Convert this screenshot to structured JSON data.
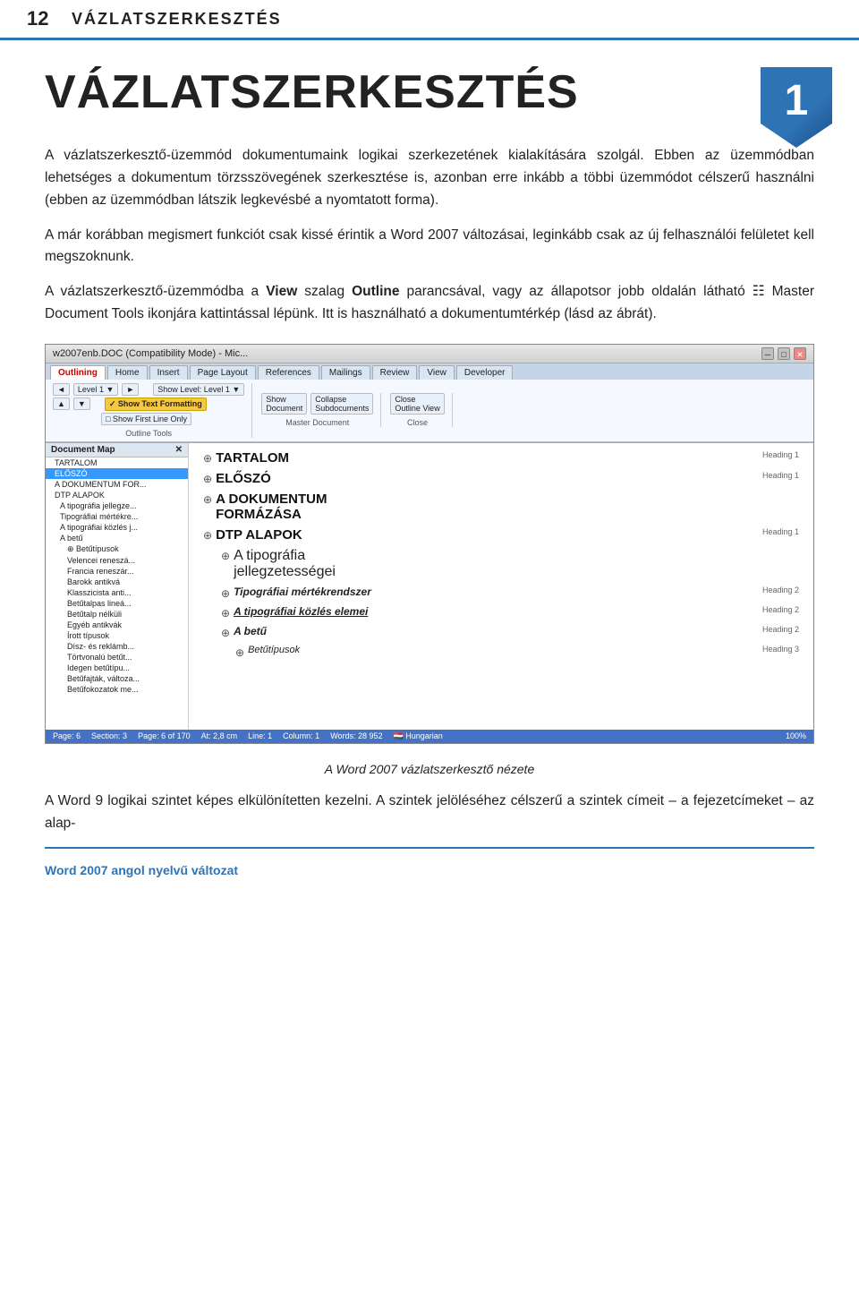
{
  "header": {
    "chapter_number": "12",
    "chapter_title": "VÁZLATSZERKESZTÉS"
  },
  "big_title": "VÁZLATSZERKESZTÉS",
  "badge_number": "1",
  "paragraphs": [
    "A vázlatszerkesztő-üzemmód dokumentumaink logikai szerkezetének kialakítására szolgál. Ebben az üzemmódban lehetséges a dokumentum törzsszövegének szerkesztése is, azonban erre inkább a többi üzemmódot célszerű használni (ebben az üzemmódban látszik legkevésbé a nyomtatott forma).",
    "A már korábban megismert funkciót csak kissé érintik a Word 2007 változásai, leginkább csak az új felhasználói felületet kell megszoknunk.",
    "A vázlatszerkesztő-üzemmódba a View szalag Outline parancsával, vagy az állapotsor jobb oldalán látható 🖹 Master Document Tools ikonjára kattintással lépünk. Itt is használható a dokumentumtérkép (lásd az ábrát)."
  ],
  "word_window": {
    "title": "w2007enb.DOC (Compatibility Mode) - Mic...",
    "tabs": [
      "Outlining",
      "Home",
      "Insert",
      "Page Layout",
      "References",
      "Mailings",
      "Review",
      "View",
      "Developer"
    ],
    "active_tab": "Outlining",
    "ribbon": {
      "groups": [
        {
          "label": "Outline Tools",
          "buttons": [
            {
              "label": "◄ Level 1 ►",
              "type": "dropdown"
            },
            {
              "label": "Show Level: Level 1",
              "type": "dropdown"
            },
            {
              "label": "Show Text Formatting",
              "type": "toggle",
              "highlighted": true
            },
            {
              "label": "Show First Line Only",
              "type": "toggle"
            }
          ]
        },
        {
          "label": "Master Document",
          "buttons": [
            {
              "label": "Show Document",
              "type": "btn"
            },
            {
              "label": "Collapse Subdocuments",
              "type": "btn"
            },
            {
              "label": "Close Outline View",
              "type": "btn"
            }
          ]
        }
      ]
    },
    "doc_map": {
      "title": "Document Map",
      "items": [
        {
          "text": "TARTALOM",
          "level": 0,
          "selected": false
        },
        {
          "text": "ELŐSZÓ",
          "level": 0,
          "selected": true
        },
        {
          "text": "A DOKUMENTUM FOR...",
          "level": 0,
          "selected": false
        },
        {
          "text": "DTP ALAPOK",
          "level": 0,
          "selected": false
        },
        {
          "text": "A tipográfia jellegze...",
          "level": 1,
          "selected": false
        },
        {
          "text": "Tipográfiai mértékre...",
          "level": 1,
          "selected": false
        },
        {
          "text": "A tipográfiai közlés j...",
          "level": 1,
          "selected": false
        },
        {
          "text": "A betű",
          "level": 1,
          "selected": false
        },
        {
          "text": "⊕ Betűtípusok",
          "level": 2,
          "selected": false
        },
        {
          "text": "Velencei reneszá...",
          "level": 2,
          "selected": false
        },
        {
          "text": "Francia reneszár...",
          "level": 2,
          "selected": false
        },
        {
          "text": "Barokk antikvá",
          "level": 2,
          "selected": false
        },
        {
          "text": "Klasszicista anti...",
          "level": 2,
          "selected": false
        },
        {
          "text": "Betűtalpas lineá...",
          "level": 2,
          "selected": false
        },
        {
          "text": "Betűtalp nélküli",
          "level": 2,
          "selected": false
        },
        {
          "text": "Egyéb antikvák",
          "level": 2,
          "selected": false
        },
        {
          "text": "Írott típusok",
          "level": 2,
          "selected": false
        },
        {
          "text": "Dísz- és reklámb...",
          "level": 2,
          "selected": false
        },
        {
          "text": "Törtvonalú betűt...",
          "level": 2,
          "selected": false
        },
        {
          "text": "Idegen betűtípu...",
          "level": 2,
          "selected": false
        },
        {
          "text": "Betűfajták, változa...",
          "level": 2,
          "selected": false
        },
        {
          "text": "Betűfokozatok me...",
          "level": 2,
          "selected": false
        }
      ]
    },
    "outline_rows": [
      {
        "bullet": "⊕",
        "text": "TARTALOM",
        "style": "h1",
        "level_label": "Heading 1"
      },
      {
        "bullet": "⊕",
        "text": "ELŐSZÓ",
        "style": "h1",
        "level_label": "Heading 1"
      },
      {
        "bullet": "⊕",
        "text": "A DOKUMENTUM\nFORMÁZÁSA",
        "style": "h1",
        "level_label": ""
      },
      {
        "bullet": "⊕",
        "text": "DTP ALAPOK",
        "style": "h1",
        "level_label": "Heading 1"
      },
      {
        "bullet": "⊕",
        "text": "A tipográfia\njellegzetességei",
        "style": "h1it",
        "level_label": ""
      },
      {
        "bullet": "⊕",
        "text": "Tipográfiai mértékrendszer",
        "style": "h2",
        "level_label": "Heading 2"
      },
      {
        "bullet": "⊕",
        "text": "A tipográfiai közlés elemei",
        "style": "h2",
        "level_label": "Heading 2"
      },
      {
        "bullet": "⊕",
        "text": "A betű",
        "style": "h2",
        "level_label": "Heading 2"
      },
      {
        "bullet": "⊕",
        "text": "Betűtípusok",
        "style": "h2",
        "level_label": "Heading 3"
      }
    ],
    "statusbar": {
      "items": [
        "Page: 6",
        "Section: 3",
        "Page: 6 of 170",
        "At: 2,8 cm",
        "Line: 1",
        "Column: 1",
        "Words: 28 952",
        "🇭🇺 Hungarian",
        "100%"
      ]
    }
  },
  "caption": "A Word 2007 vázlatszerkesztő nézete",
  "bottom_paragraphs": [
    "A Word 9 logikai szintet képes elkülönítetten kezelni. A szintek jelöléséhez célszerű a szintek címeit – a fejezetcímeket – az alap-"
  ],
  "bottom_label": "Word 2007 angol nyelvű változat"
}
